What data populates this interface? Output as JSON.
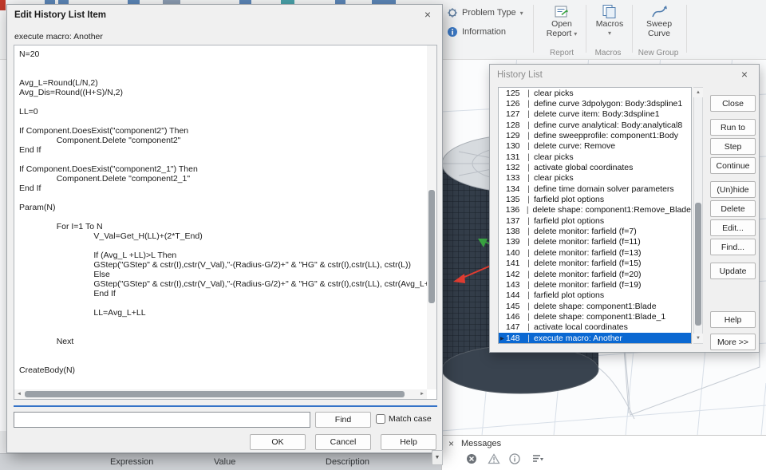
{
  "icons": {
    "close": "×",
    "chevron_down": "▾",
    "run_arrow": "▶",
    "separator": "|",
    "info": "i",
    "scroll_up": "▲",
    "scroll_down": "▼",
    "scroll_left": "◄",
    "scroll_right": "►"
  },
  "ribbon": {
    "problem_type_label": "Problem Type",
    "information_label": "Information",
    "open_report_line1": "Open",
    "open_report_line2": "Report",
    "macros_label": "Macros",
    "sweep_line1": "Sweep",
    "sweep_line2": "Curve",
    "group_report": "Report",
    "group_macros": "Macros",
    "group_new_group": "New Group"
  },
  "edit_dialog": {
    "title": "Edit History List Item",
    "macro_label": "execute macro: Another",
    "code": "N=20\n\n\nAvg_L=Round(L/N,2)\nAvg_Dis=Round((H+S)/N,2)\n\nLL=0\n\nIf Component.DoesExist(\"component2\") Then\n\tComponent.Delete \"component2\"\nEnd If\n\nIf Component.DoesExist(\"component2_1\") Then\n\tComponent.Delete \"component2_1\"\nEnd If\n\nParam(N)\n\n\tFor I=1 To N\n\t\tV_Val=Get_H(LL)+(2*T_End)\n\n\t\tIf (Avg_L +LL)>L Then\n\t\tGStep(\"GStep\" & cstr(I),cstr(V_Val),\"-(Radius-G/2)+\" & \"HG\" & cstr(I),cstr(LL), cstr(L))\n\t\tElse\n\t\tGStep(\"GStep\" & cstr(I),cstr(V_Val),\"-(Radius-G/2)+\" & \"HG\" & cstr(I),cstr(LL), cstr(Avg_L+LL\n\t\tEnd If\n\n\t\tLL=Avg_L+LL\n\n\n\tNext\n\n\nCreateBody(N)\n",
    "find_value": "",
    "find_button": "Find",
    "match_case_label": "Match case",
    "ok_button": "OK",
    "cancel_button": "Cancel",
    "help_button": "Help"
  },
  "history_dialog": {
    "title": "History List",
    "selected_index": 23,
    "items": [
      {
        "num": "125",
        "text": "clear picks"
      },
      {
        "num": "126",
        "text": "define curve 3dpolygon: Body:3dspline1"
      },
      {
        "num": "127",
        "text": "delete curve item: Body:3dspline1"
      },
      {
        "num": "128",
        "text": "define curve analytical: Body:analytical8"
      },
      {
        "num": "129",
        "text": "define sweepprofile: component1:Body"
      },
      {
        "num": "130",
        "text": "delete curve: Remove"
      },
      {
        "num": "131",
        "text": "clear picks"
      },
      {
        "num": "132",
        "text": "activate global coordinates"
      },
      {
        "num": "133",
        "text": "clear picks"
      },
      {
        "num": "134",
        "text": "define time domain solver parameters"
      },
      {
        "num": "135",
        "text": "farfield plot options"
      },
      {
        "num": "136",
        "text": "delete shape: component1:Remove_Blade"
      },
      {
        "num": "137",
        "text": "farfield plot options"
      },
      {
        "num": "138",
        "text": "delete monitor: farfield (f=7)"
      },
      {
        "num": "139",
        "text": "delete monitor: farfield (f=11)"
      },
      {
        "num": "140",
        "text": "delete monitor: farfield (f=13)"
      },
      {
        "num": "141",
        "text": "delete monitor: farfield (f=15)"
      },
      {
        "num": "142",
        "text": "delete monitor: farfield (f=20)"
      },
      {
        "num": "143",
        "text": "delete monitor: farfield (f=19)"
      },
      {
        "num": "144",
        "text": "farfield plot options"
      },
      {
        "num": "145",
        "text": "delete shape: component1:Blade"
      },
      {
        "num": "146",
        "text": "delete shape: component1:Blade_1"
      },
      {
        "num": "147",
        "text": "activate local coordinates"
      },
      {
        "num": "148",
        "text": "execute macro: Another"
      }
    ],
    "buttons": [
      {
        "name": "close-button",
        "label": "Close"
      },
      {
        "name": "run-to-button",
        "label": "Run to"
      },
      {
        "name": "step-button",
        "label": "Step"
      },
      {
        "name": "continue-button",
        "label": "Continue"
      },
      {
        "name": "unhide-button",
        "label": "(Un)hide"
      },
      {
        "name": "delete-button",
        "label": "Delete"
      },
      {
        "name": "edit-button",
        "label": "Edit..."
      },
      {
        "name": "find-button",
        "label": "Find..."
      },
      {
        "name": "update-button",
        "label": "Update"
      },
      {
        "name": "help-button",
        "label": "Help"
      },
      {
        "name": "more-button",
        "label": "More >>"
      }
    ]
  },
  "messages": {
    "tab_label": "Messages"
  },
  "parameter_list": {
    "columns": [
      "Expression",
      "Value",
      "Description"
    ]
  }
}
